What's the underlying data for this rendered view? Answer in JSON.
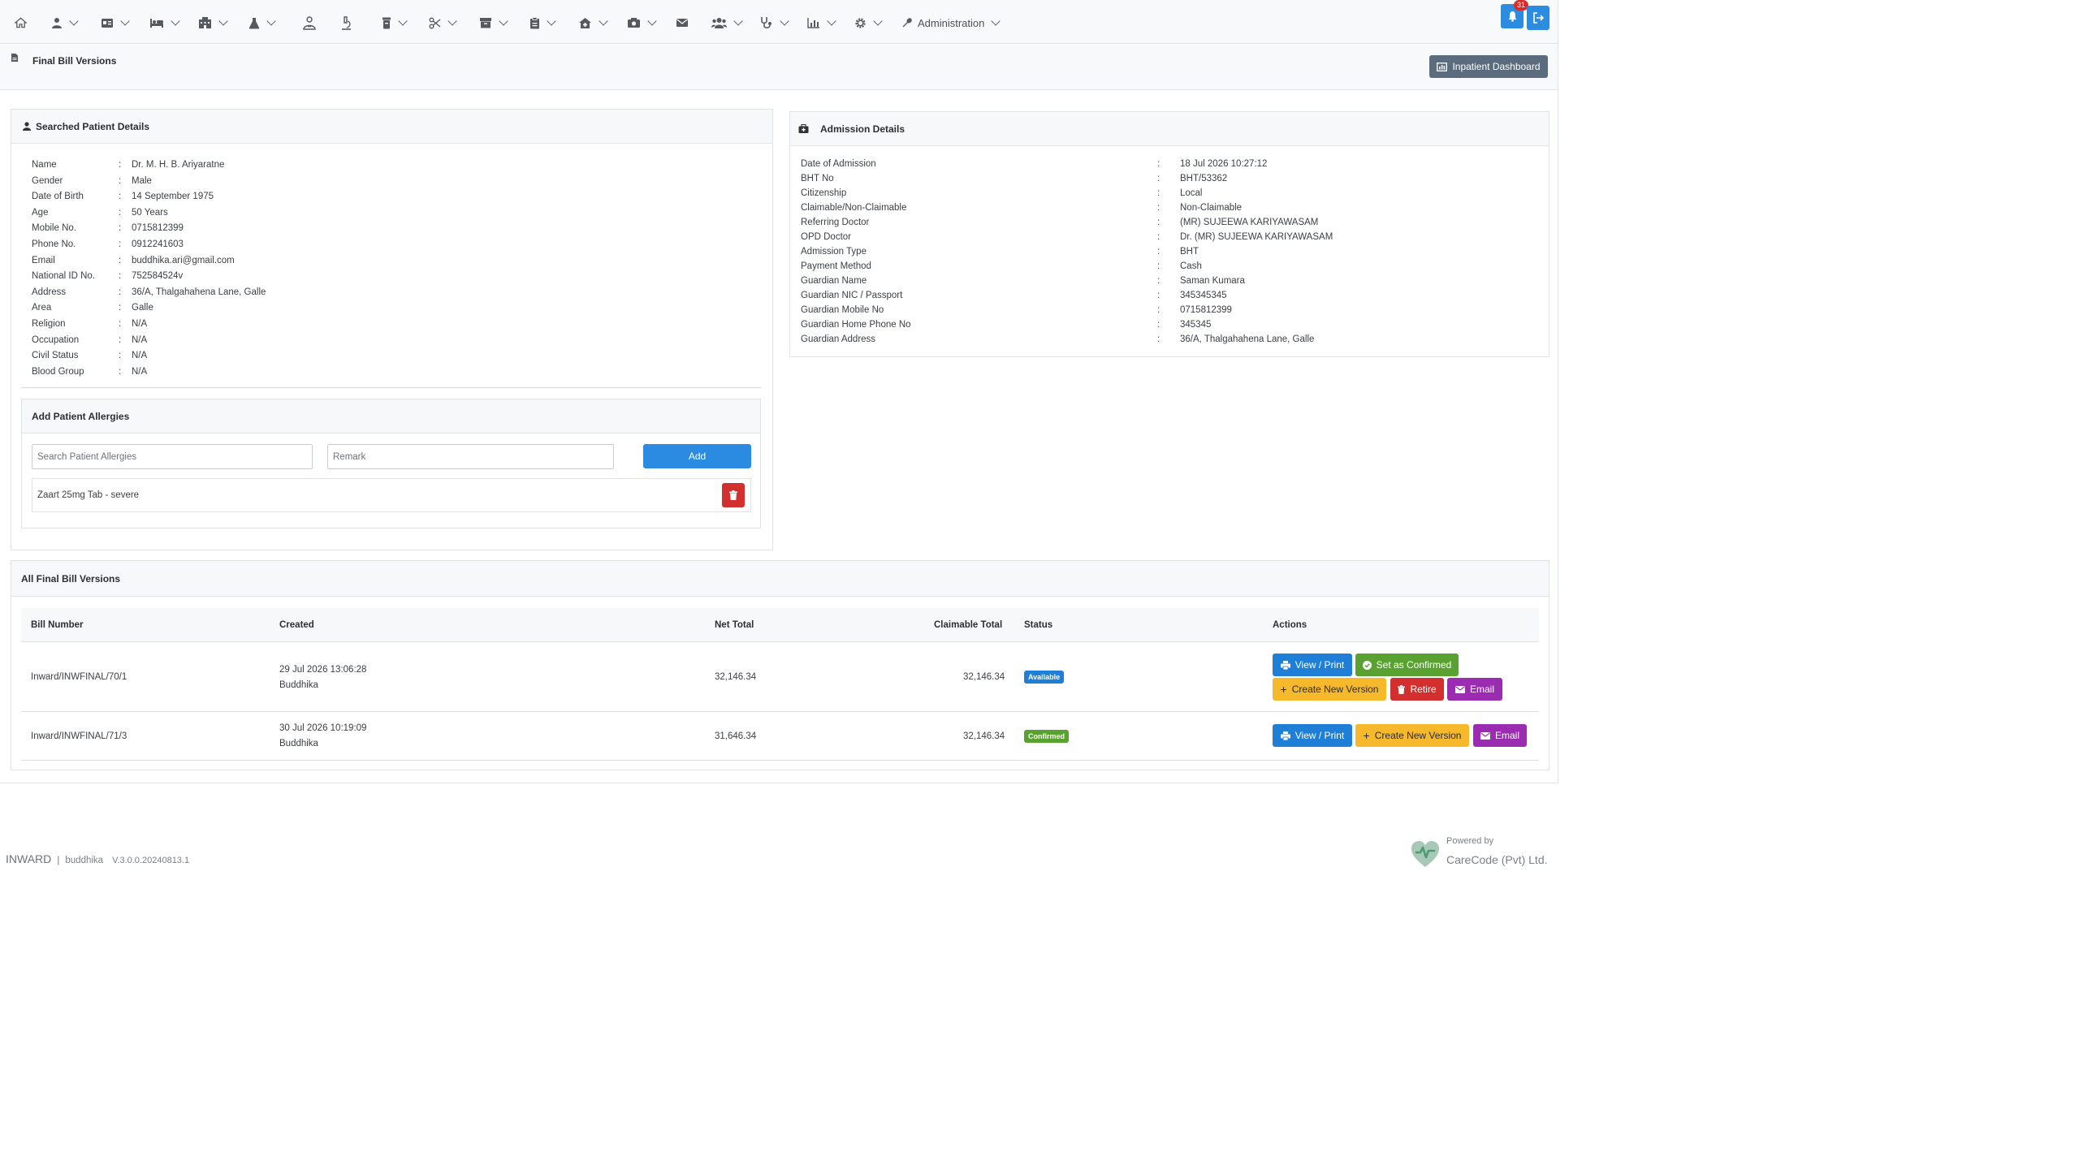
{
  "navbar": {
    "admin_label": "Administration",
    "notification_count": "31"
  },
  "page": {
    "title": "Final Bill Versions",
    "dashboard_button": "Inpatient Dashboard"
  },
  "patient": {
    "header": "Searched Patient Details",
    "fields": [
      {
        "label": "Name",
        "value": "Dr. M. H. B. Ariyaratne"
      },
      {
        "label": "Gender",
        "value": "Male"
      },
      {
        "label": "Date of Birth",
        "value": "14 September 1975"
      },
      {
        "label": "Age",
        "value": "50 Years"
      },
      {
        "label": "Mobile No.",
        "value": "0715812399"
      },
      {
        "label": "Phone No.",
        "value": "0912241603"
      },
      {
        "label": "Email",
        "value": "buddhika.ari@gmail.com"
      },
      {
        "label": "National ID No.",
        "value": "752584524v"
      },
      {
        "label": "Address",
        "value": "36/A, Thalgahahena Lane, Galle"
      },
      {
        "label": "Area",
        "value": "Galle"
      },
      {
        "label": "Religion",
        "value": "N/A"
      },
      {
        "label": "Occupation",
        "value": "N/A"
      },
      {
        "label": "Civil Status",
        "value": "N/A"
      },
      {
        "label": "Blood Group",
        "value": "N/A"
      }
    ]
  },
  "allergies": {
    "header": "Add Patient Allergies",
    "search_placeholder": "Search Patient Allergies",
    "remark_placeholder": "Remark",
    "add_label": "Add",
    "items": [
      {
        "text": "Zaart 25mg Tab - severe"
      }
    ]
  },
  "admission": {
    "header": "Admission Details",
    "fields": [
      {
        "label": "Date of Admission",
        "value": "18 Jul 2026 10:27:12"
      },
      {
        "label": "BHT No",
        "value": "BHT/53362"
      },
      {
        "label": "Citizenship",
        "value": "Local"
      },
      {
        "label": "Claimable/Non-Claimable",
        "value": "Non-Claimable"
      },
      {
        "label": "Referring Doctor",
        "value": "(MR) SUJEEWA KARIYAWASAM"
      },
      {
        "label": "OPD Doctor",
        "value": "Dr. (MR) SUJEEWA KARIYAWASAM"
      },
      {
        "label": "Admission Type",
        "value": "BHT"
      },
      {
        "label": "Payment Method",
        "value": "Cash"
      },
      {
        "label": "Guardian Name",
        "value": "Saman Kumara"
      },
      {
        "label": "Guardian NIC / Passport",
        "value": "345345345"
      },
      {
        "label": "Guardian Mobile No",
        "value": "0715812399"
      },
      {
        "label": "Guardian Home Phone No",
        "value": "345345"
      },
      {
        "label": "Guardian Address",
        "value": "36/A, Thalgahahena Lane, Galle"
      }
    ]
  },
  "bills": {
    "header": "All Final Bill Versions",
    "columns": {
      "bill_number": "Bill Number",
      "created": "Created",
      "net_total": "Net Total",
      "claimable_total": "Claimable Total",
      "status": "Status",
      "actions": "Actions"
    },
    "rows": [
      {
        "bill_number": "Inward/INWFINAL/70/1",
        "created_date": "29 Jul 2026 13:06:28",
        "created_by": "Buddhika",
        "net_total": "32,146.34",
        "claimable_total": "32,146.34",
        "status": "Available",
        "status_color": "#1f7fd6"
      },
      {
        "bill_number": "Inward/INWFINAL/71/3",
        "created_date": "30 Jul 2026 10:19:09",
        "created_by": "Buddhika",
        "net_total": "31,646.34",
        "claimable_total": "32,146.34",
        "status": "Confirmed",
        "status_color": "#59a232"
      }
    ],
    "actions": {
      "view_print": "View / Print",
      "set_confirmed": "Set as Confirmed",
      "create_new_version": "Create New Version",
      "retire": "Retire",
      "email": "Email"
    }
  },
  "footer": {
    "app_name": "INWARD",
    "separator": "|",
    "user": "buddhika",
    "version": "V.3.0.0.20240813.1",
    "powered_by": "Powered by",
    "company": "CareCode (Pvt) Ltd."
  },
  "colors": {
    "primary": "#1f7fd6",
    "success": "#59a232",
    "warning": "#f6b92b",
    "danger": "#d32f2f",
    "purple": "#9b2bb0",
    "secondary": "#5a6c7d"
  }
}
